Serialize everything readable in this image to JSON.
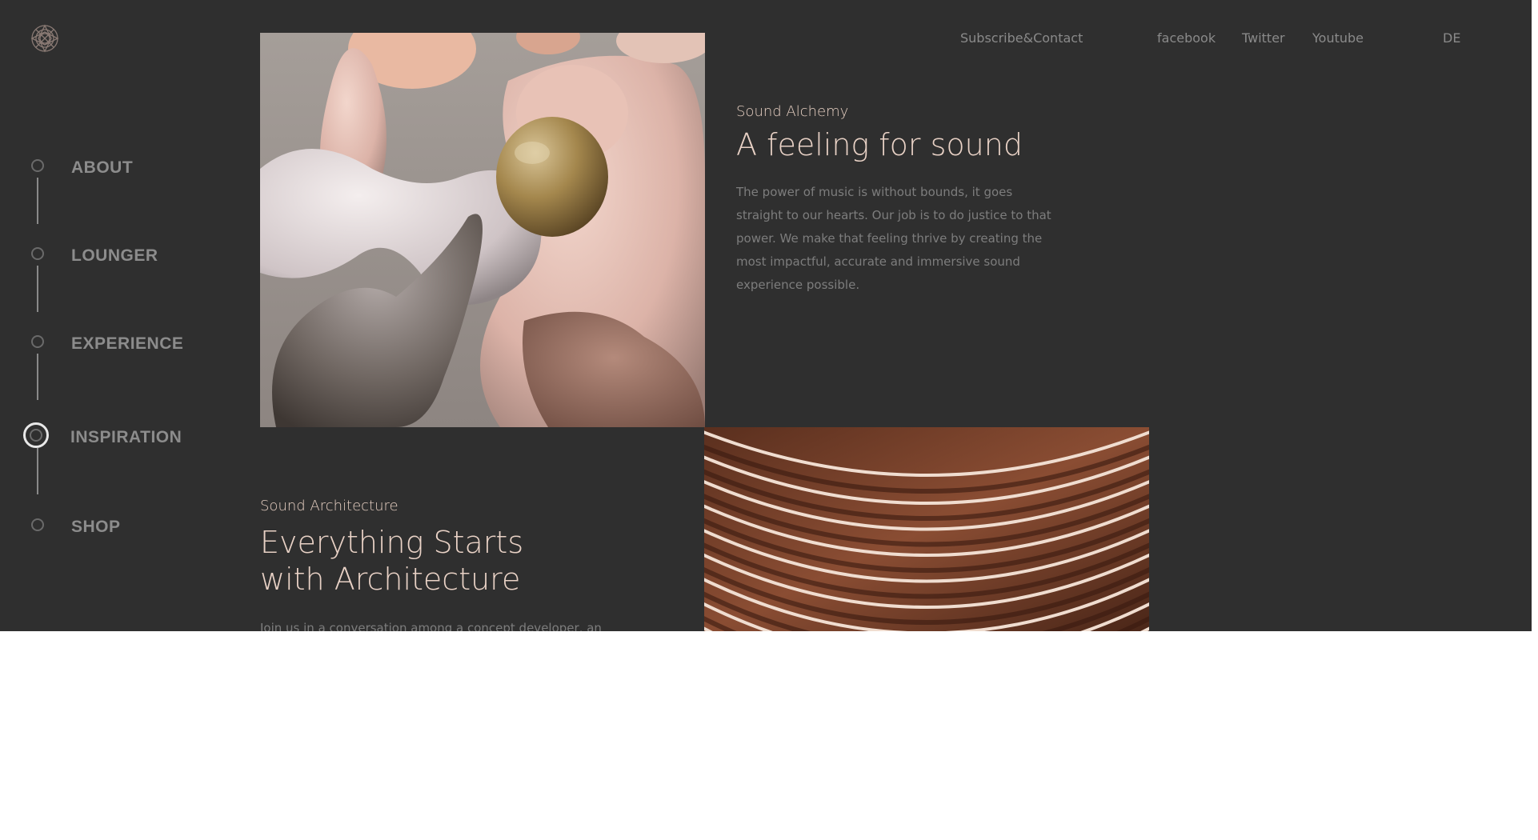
{
  "header": {
    "logo_name": "brand-logo",
    "links": {
      "subscribe": "Subscribe&Contact",
      "facebook": "facebook",
      "twitter": "Twitter",
      "youtube": "Youtube",
      "language": "DE"
    }
  },
  "sidebar": {
    "items": [
      {
        "label": "ABOUT",
        "active": false
      },
      {
        "label": "LOUNGER",
        "active": false
      },
      {
        "label": "EXPERIENCE",
        "active": false
      },
      {
        "label": "INSPIRATION",
        "active": true
      },
      {
        "label": "SHOP",
        "active": false
      }
    ]
  },
  "sections": {
    "alchemy": {
      "eyebrow": "Sound Alchemy",
      "title": "A feeling for sound",
      "body": "The power of music is without bounds, it goes straight to our hearts. Our job is to do justice to that power. We make that feeling thrive by creating the most impactful, accurate and immersive sound experience possible."
    },
    "architecture": {
      "eyebrow": "Sound Architecture",
      "title_line1": "Everything Starts",
      "title_line2": "with Architecture",
      "body": "Join us in a conversation among a concept developer, an"
    }
  },
  "colors": {
    "background": "#2f2f2f",
    "accent": "#e9d2c6",
    "muted_text": "#7d7d7d"
  }
}
